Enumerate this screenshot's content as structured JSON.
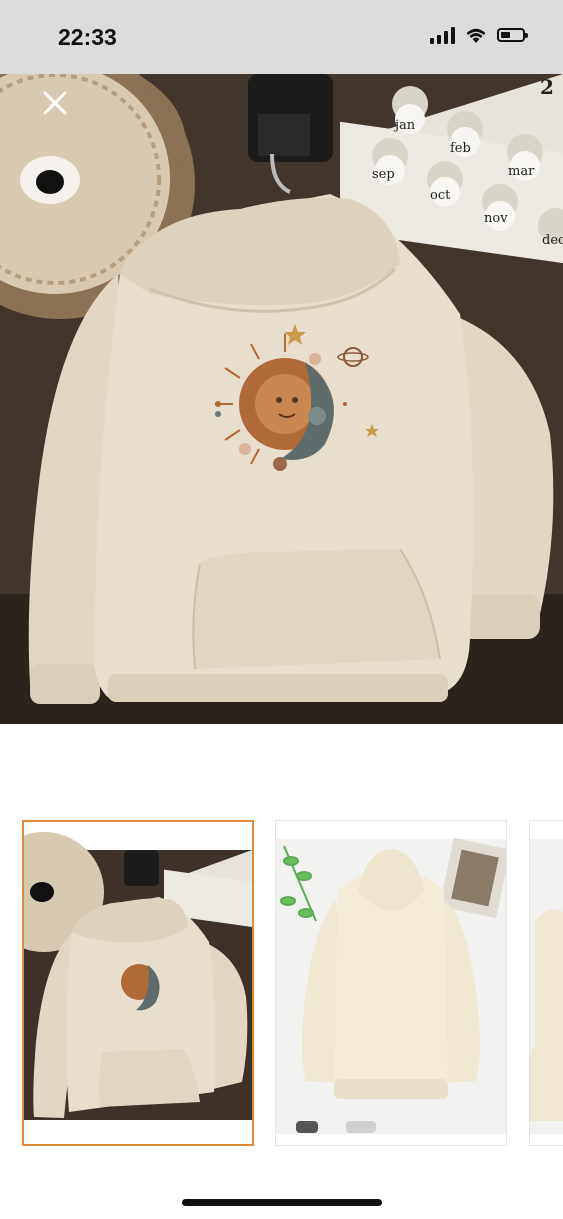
{
  "status_bar": {
    "time": "22:33",
    "signal_icon": "cellular-signal-icon",
    "wifi_icon": "wifi-icon",
    "battery_icon": "battery-icon",
    "battery_level": 0.45
  },
  "viewer": {
    "close_icon": "close-icon",
    "calendar_months": [
      "jan",
      "feb",
      "mar",
      "sep",
      "oct",
      "nov",
      "dec"
    ],
    "calendar_corner_number": "2"
  },
  "thumbnails": [
    {
      "selected": true
    },
    {
      "selected": false
    },
    {
      "selected": false
    }
  ],
  "colors": {
    "status_bar_bg": "#dcdcdc",
    "selected_thumb_border": "#e08a3c",
    "hoodie": "#e6dccb",
    "table": "#3a2e26"
  }
}
